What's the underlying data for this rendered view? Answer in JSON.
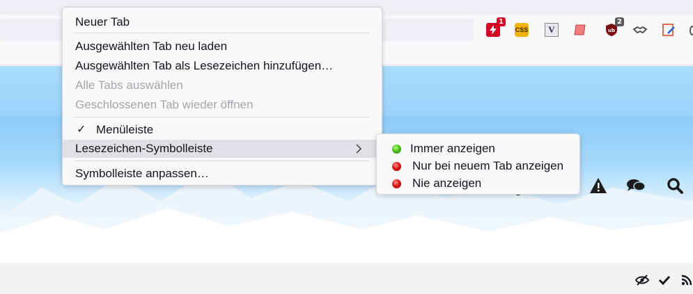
{
  "toolbar": {
    "extensions": [
      {
        "icon": "flash-red-icon",
        "badge": "1",
        "badge_color": "#d70022"
      },
      {
        "icon": "css-icon",
        "label": "CSS"
      },
      {
        "icon": "vimium-icon",
        "label": "V"
      },
      {
        "icon": "scroll-icon"
      },
      {
        "icon": "ublock-icon",
        "badge": "2",
        "badge_color": "#5a5a5a"
      },
      {
        "icon": "handshake-icon"
      },
      {
        "icon": "edit-page-icon"
      }
    ]
  },
  "context_menu": {
    "items": [
      {
        "label": "Neuer Tab",
        "disabled": false
      },
      {
        "label": "Ausgewählten Tab neu laden",
        "disabled": false
      },
      {
        "label": "Ausgewählten Tab als Lesezeichen hinzufügen…",
        "disabled": false
      },
      {
        "label": "Alle Tabs auswählen",
        "disabled": true
      },
      {
        "label": "Geschlossenen Tab wieder öffnen",
        "disabled": true
      },
      {
        "label": "Menüleiste",
        "checked": true
      },
      {
        "label": "Lesezeichen-Symbolleiste",
        "submenu": true,
        "active": true
      },
      {
        "label": "Symbolleiste anpassen…",
        "disabled": false
      }
    ]
  },
  "submenu": {
    "items": [
      {
        "label": "Immer anzeigen",
        "status": "green"
      },
      {
        "label": "Nur bei neuem Tab anzeigen",
        "status": "red"
      },
      {
        "label": "Nie anzeigen",
        "status": "red"
      }
    ]
  },
  "page_icons": [
    "warning-icon",
    "chat-icon",
    "search-icon"
  ],
  "status_icons": [
    "hidden-eye-icon",
    "checkmark-icon",
    "rss-icon"
  ],
  "colors": {
    "sky": "#9dd4fb",
    "menu_bg": "#f9f9fb",
    "menu_active": "#e0e0e6",
    "disabled_text": "#a6a6aa"
  }
}
